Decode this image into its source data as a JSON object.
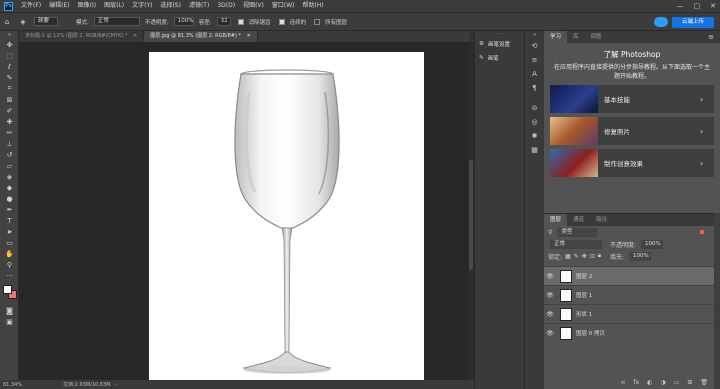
{
  "menubar": {
    "logo": "Ps",
    "items": [
      "文件(F)",
      "编辑(E)",
      "图像(I)",
      "图层(L)",
      "文字(Y)",
      "选择(S)",
      "滤镜(T)",
      "3D(D)",
      "视图(V)",
      "窗口(W)",
      "帮助(H)"
    ],
    "controls": [
      "—",
      "▢",
      "✕"
    ]
  },
  "optbar": {
    "brush_mode": "颜要",
    "mode_label": "模式:",
    "mode_value": "正常",
    "opacity_label": "不透明度:",
    "opacity_value": "100%",
    "tolerance_label": "容差:",
    "tolerance_value": "32",
    "anti_alias": "消除锯齿",
    "contiguous": "连续的",
    "all_layers": "所有图层",
    "share_label": "云端上传"
  },
  "tabs": [
    {
      "label": "未标题-1 @ 11% (图层 2, RGB/8#/CMYK) *",
      "active": false
    },
    {
      "label": "图层.jpg @ 81.3% (图层 2, RGB/8#) *",
      "active": true
    }
  ],
  "status": {
    "zoom": "81.34%",
    "doc": "文档:2.93M/10.83M"
  },
  "midpanel": {
    "items": [
      "画笔设置",
      "画笔"
    ]
  },
  "learn": {
    "tabs": [
      "学习",
      "库",
      "调整"
    ],
    "title": "了解 Photoshop",
    "subtitle": "在应用程序内直接提供的分步指导教程。从下面选取一个主题开始教程。",
    "cards": [
      {
        "label": "基本技能",
        "color": "#1c2a66"
      },
      {
        "label": "修复照片",
        "color": "#b06a2f"
      },
      {
        "label": "制作创意效果",
        "color": "#7a2a2a"
      }
    ]
  },
  "layers": {
    "tabs": [
      "图层",
      "通道",
      "路径"
    ],
    "filter": "类型",
    "blend": "正常",
    "opacity_label": "不透明度:",
    "opacity_value": "100%",
    "lock_label": "锁定:",
    "fill_label": "填充:",
    "fill_value": "100%",
    "items": [
      {
        "name": "图层 2",
        "selected": true
      },
      {
        "name": "图层 1",
        "selected": false
      },
      {
        "name": "形状 1",
        "selected": false
      },
      {
        "name": "图层 0 拷贝",
        "selected": false
      }
    ]
  },
  "colors": {
    "accent": "#1473e6",
    "foreground": "#ffffff",
    "background": "#ea7677"
  }
}
